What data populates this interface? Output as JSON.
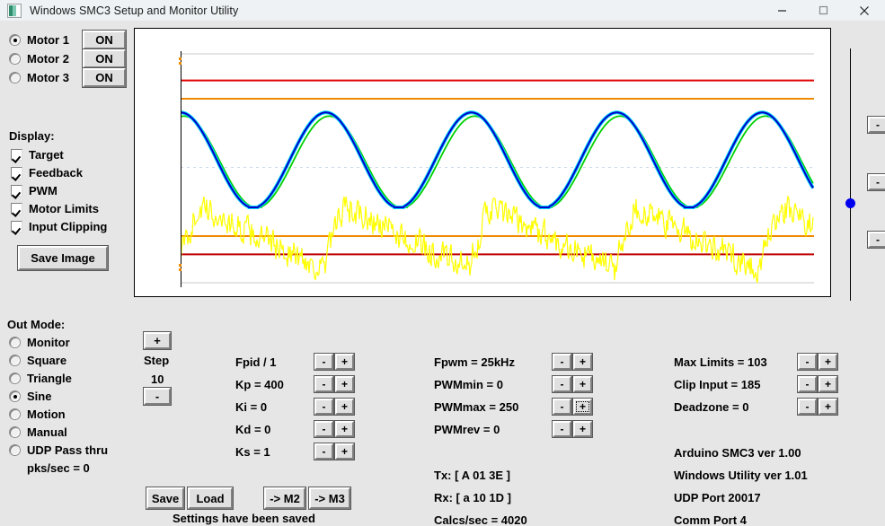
{
  "window": {
    "title": "Windows SMC3 Setup and Monitor Utility",
    "icon": "app-window-icon",
    "minimize": "—",
    "maximize": "□",
    "close": "✕"
  },
  "motors": {
    "items": [
      {
        "label": "Motor 1",
        "selected": true,
        "button": "ON"
      },
      {
        "label": "Motor 2",
        "selected": false,
        "button": "ON"
      },
      {
        "label": "Motor 3",
        "selected": false,
        "button": "ON"
      }
    ]
  },
  "display": {
    "heading": "Display:",
    "items": [
      {
        "label": "Target",
        "checked": true
      },
      {
        "label": "Feedback",
        "checked": true
      },
      {
        "label": "PWM",
        "checked": true
      },
      {
        "label": "Motor Limits",
        "checked": true
      },
      {
        "label": "Input Clipping",
        "checked": true
      }
    ],
    "save_image_label": "Save Image"
  },
  "out_mode": {
    "heading": "Out Mode:",
    "items": [
      {
        "label": "Monitor",
        "selected": false
      },
      {
        "label": "Square",
        "selected": false
      },
      {
        "label": "Triangle",
        "selected": false
      },
      {
        "label": "Sine",
        "selected": true
      },
      {
        "label": "Motion",
        "selected": false
      },
      {
        "label": "Manual",
        "selected": false
      },
      {
        "label": "UDP Pass thru",
        "selected": false
      }
    ],
    "pks_per_sec": "pks/sec = 0"
  },
  "step": {
    "plus": "+",
    "label": "Step",
    "value": "10",
    "minus": "-"
  },
  "pid": {
    "rows": [
      {
        "label": "Fpid / 1",
        "minus": "-",
        "plus": "+"
      },
      {
        "label": "Kp = 400",
        "minus": "-",
        "plus": "+"
      },
      {
        "label": "Ki = 0",
        "minus": "-",
        "plus": "+"
      },
      {
        "label": "Kd = 0",
        "minus": "-",
        "plus": "+"
      },
      {
        "label": "Ks = 1",
        "minus": "-",
        "plus": "+"
      }
    ]
  },
  "actions": {
    "save": "Save",
    "load": "Load",
    "to_m2": "-> M2",
    "to_m3": "-> M3",
    "status": "Settings have been saved"
  },
  "pwm": {
    "rows": [
      {
        "label": "Fpwm = 25kHz",
        "minus": "-",
        "plus": "+",
        "plus_focused": false
      },
      {
        "label": "PWMmin = 0",
        "minus": "-",
        "plus": "+",
        "plus_focused": false
      },
      {
        "label": "PWMmax = 250",
        "minus": "-",
        "plus": "+",
        "plus_focused": true
      },
      {
        "label": "PWMrev = 0",
        "minus": "-",
        "plus": "+",
        "plus_focused": false
      }
    ],
    "tx": "Tx: [ A 01 3E ]",
    "rx": "Rx: [ a 10 1D ]",
    "calcs": "Calcs/sec = 4020"
  },
  "limits": {
    "rows": [
      {
        "label": "Max Limits = 103",
        "minus": "-",
        "plus": "+"
      },
      {
        "label": "Clip Input = 185",
        "minus": "-",
        "plus": "+"
      },
      {
        "label": "Deadzone = 0",
        "minus": "-",
        "plus": "+"
      }
    ],
    "info": [
      "Arduino SMC3 ver 1.00",
      "Windows Utility ver 1.01",
      "UDP Port 20017",
      "Comm Port 4"
    ]
  },
  "side_gauge": {
    "dot_color": "#0000ee",
    "minus_buttons": [
      "-",
      "-",
      "-"
    ]
  },
  "chart_data": {
    "type": "line",
    "title": "",
    "xlabel": "",
    "ylabel": "",
    "grid": false,
    "legend_position": "none",
    "xlim": [
      0,
      700
    ],
    "ylim": [
      0,
      255
    ],
    "reference_lines": [
      {
        "name": "frame-top",
        "color": "#c8c8c8",
        "y": 252,
        "style": "solid",
        "width": 1
      },
      {
        "name": "frame-bottom",
        "color": "#c8c8c8",
        "y": 2,
        "style": "solid",
        "width": 1
      },
      {
        "name": "motor-limit-high",
        "color": "#e00000",
        "y": 223,
        "style": "solid",
        "width": 2
      },
      {
        "name": "clip-input-high",
        "color": "#ef8a00",
        "y": 203,
        "style": "solid",
        "width": 2
      },
      {
        "name": "center-dashed",
        "color": "#c9d9ea",
        "y": 128,
        "style": "dashed",
        "width": 1
      },
      {
        "name": "clip-input-low",
        "color": "#ef8a00",
        "y": 53,
        "style": "solid",
        "width": 2
      },
      {
        "name": "motor-limit-low",
        "color": "#c00000",
        "y": 33,
        "style": "solid",
        "width": 2
      }
    ],
    "series": [
      {
        "name": "Target",
        "color": "#0000c8",
        "halo_color": "#00d7ff",
        "waveform": "sine",
        "cycles": 4.35,
        "phase_deg": 90,
        "amplitude": 52,
        "offset": 136,
        "flat_clip_low": true
      },
      {
        "name": "Feedback",
        "color": "#00d000",
        "waveform": "sine",
        "cycles": 4.35,
        "phase_deg": 82,
        "amplitude": 50,
        "offset": 134,
        "flat_clip_low": true
      },
      {
        "name": "PWM",
        "color": "#ffff00",
        "waveform": "noisy-sawtooth",
        "cycles": 4.35,
        "mean": 48,
        "noise": 22,
        "min": 2,
        "max": 96
      }
    ]
  }
}
